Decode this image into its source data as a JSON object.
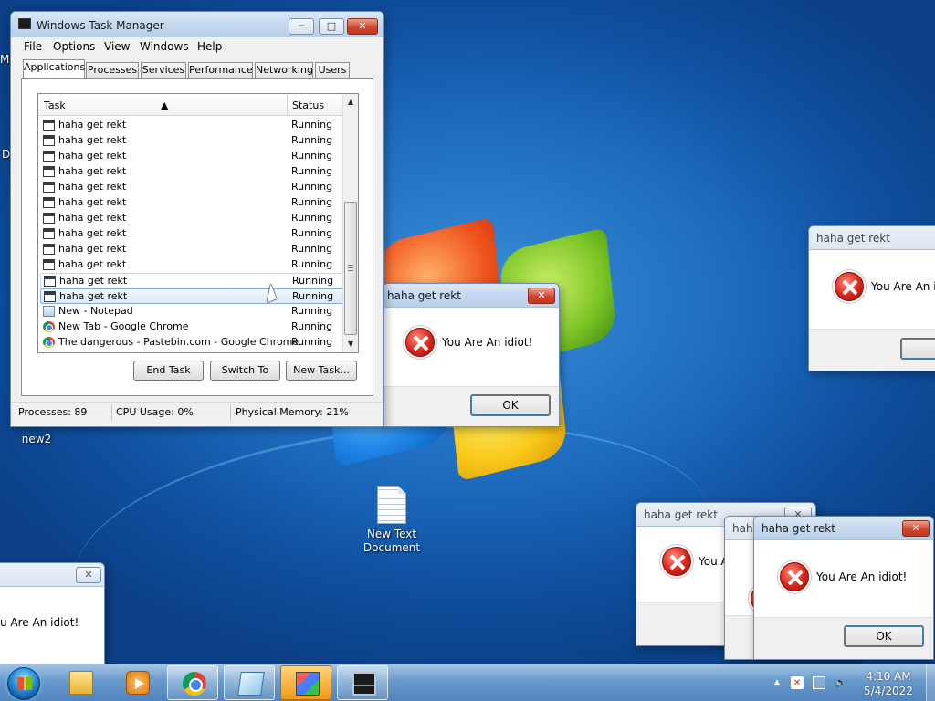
{
  "desktop": {
    "icons": [
      {
        "label": "new2"
      },
      {
        "label": "New Text Document"
      }
    ],
    "edge_letters": [
      "M",
      "D"
    ]
  },
  "task_manager": {
    "title": "Windows Task Manager",
    "controls": {
      "minimize": "─",
      "maximize": "□",
      "close": "✕"
    },
    "menu": [
      "File",
      "Options",
      "View",
      "Windows",
      "Help"
    ],
    "tabs": [
      "Applications",
      "Processes",
      "Services",
      "Performance",
      "Networking",
      "Users"
    ],
    "active_tab": "Applications",
    "columns": {
      "task": "Task",
      "status": "Status"
    },
    "rows": [
      {
        "task": "haha get rekt",
        "status": "Running",
        "icon": "window-icon"
      },
      {
        "task": "haha get rekt",
        "status": "Running",
        "icon": "window-icon"
      },
      {
        "task": "haha get rekt",
        "status": "Running",
        "icon": "window-icon"
      },
      {
        "task": "haha get rekt",
        "status": "Running",
        "icon": "window-icon"
      },
      {
        "task": "haha get rekt",
        "status": "Running",
        "icon": "window-icon"
      },
      {
        "task": "haha get rekt",
        "status": "Running",
        "icon": "window-icon"
      },
      {
        "task": "haha get rekt",
        "status": "Running",
        "icon": "window-icon"
      },
      {
        "task": "haha get rekt",
        "status": "Running",
        "icon": "window-icon"
      },
      {
        "task": "haha get rekt",
        "status": "Running",
        "icon": "window-icon"
      },
      {
        "task": "haha get rekt",
        "status": "Running",
        "icon": "window-icon"
      },
      {
        "task": "haha get rekt",
        "status": "Running",
        "icon": "window-icon"
      },
      {
        "task": "haha get rekt",
        "status": "Running",
        "icon": "window-icon"
      },
      {
        "task": "New - Notepad",
        "status": "Running",
        "icon": "notepad-icon"
      },
      {
        "task": "New Tab - Google Chrome",
        "status": "Running",
        "icon": "chrome-icon"
      },
      {
        "task": "The dangerous - Pastebin.com - Google Chrome",
        "status": "Running",
        "icon": "chrome-icon"
      }
    ],
    "selected_row": 11,
    "buttons": {
      "end_task": "End Task",
      "switch_to": "Switch To",
      "new_task": "New Task..."
    },
    "statusbar": {
      "processes": "Processes: 89",
      "cpu": "CPU Usage: 0%",
      "memory": "Physical Memory: 21%"
    }
  },
  "dialogs": {
    "title": "haha get rekt",
    "title_partial": "haha",
    "message": "You Are An idiot!",
    "message_partial_right": "You Are An idi",
    "message_partial_small": "You A",
    "message_partial_left": "u Are An idiot!",
    "ok": "OK",
    "ok_partial": "C",
    "close": "✕"
  },
  "taskbar": {
    "apps": [
      "explorer-icon",
      "media-player-icon",
      "chrome-icon",
      "notepad-icon",
      "paint-3d-icon",
      "task-manager-icon"
    ],
    "tray": {
      "expand": "▲"
    },
    "clock": {
      "time": "4:10 AM",
      "date": "5/4/2022"
    }
  }
}
